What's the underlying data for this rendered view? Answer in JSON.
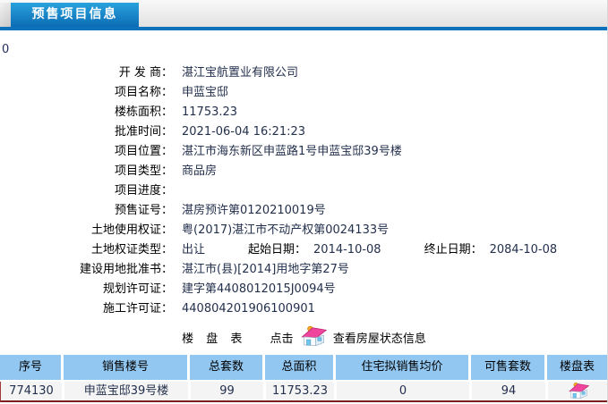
{
  "header": {
    "tab_label": "预售项目信息"
  },
  "stray_text": "0",
  "form": {
    "rows": [
      {
        "label": "开 发 商：",
        "value": "湛江宝航置业有限公司"
      },
      {
        "label": "项目名称：",
        "value": "申蓝宝邸"
      },
      {
        "label": "楼栋面积：",
        "value": "11753.23"
      },
      {
        "label": "批准时间：",
        "value": "2021-06-04 16:21:23"
      },
      {
        "label": "项目位置：",
        "value": "湛江市海东新区申蓝路1号申蓝宝邸39号楼"
      },
      {
        "label": "项目类型：",
        "value": "商品房"
      },
      {
        "label": "项目进度：",
        "value": ""
      },
      {
        "label": "预售证号：",
        "value": "湛房预许第0120210019号"
      },
      {
        "label": "土地使用权证：",
        "value": "粤(2017)湛江市不动产权第0024133号"
      },
      {
        "label": "土地权证类型：",
        "value": "出让",
        "extras": [
          {
            "label": "起始日期：",
            "value": "2014-10-08"
          },
          {
            "label": "终止日期：",
            "value": "2084-10-08"
          }
        ]
      },
      {
        "label": "建设用地批准书：",
        "value": "湛江市(县)[2014]用地字第27号"
      },
      {
        "label": "规划许可证：",
        "value": "建字第4408012015J0094号"
      },
      {
        "label": "施工许可证：",
        "value": "440804201906100901"
      }
    ]
  },
  "loupan_line": {
    "title": "楼 盘 表",
    "click_label": "点击",
    "link_label": "查看房屋状态信息",
    "icon": "house-icon"
  },
  "table": {
    "headers": [
      "序号",
      "销售楼号",
      "总套数",
      "总面积",
      "住宅拟销售均价",
      "可售套数",
      "楼盘表"
    ],
    "rows": [
      {
        "cells": [
          "774130",
          "申蓝宝邸39号楼",
          "99",
          "11753.23",
          "0",
          "94"
        ],
        "icon": "house-icon"
      }
    ]
  },
  "colors": {
    "tab_blue_top": "#29a2dd",
    "tab_blue_bottom": "#0c6cb5",
    "tab_underline": "#0d72bc",
    "table_header_bg": "#92c7f1",
    "table_row_bg": "#f4f4f4",
    "table_bottom_border": "#7e2022",
    "house_roof_pink": "#f0459c",
    "house_chimney_orange": "#f7a823",
    "house_window_blue": "#6fc5ee"
  }
}
